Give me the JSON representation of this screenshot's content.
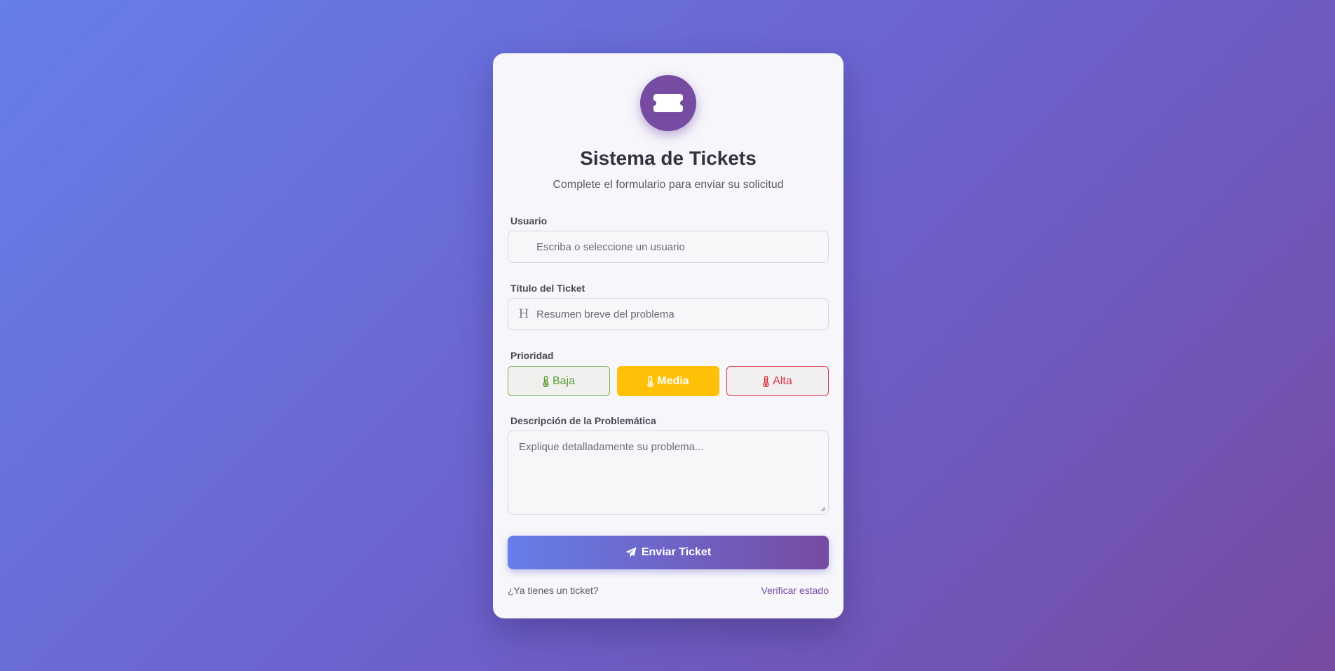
{
  "header": {
    "logo_icon": "ticket-icon",
    "title": "Sistema de Tickets",
    "subtitle": "Complete el formulario para enviar su solicitud"
  },
  "form": {
    "user": {
      "label": "Usuario",
      "placeholder": "Escriba o seleccione un usuario",
      "value": ""
    },
    "ticket_title": {
      "label": "Título del Ticket",
      "icon": "heading-icon",
      "placeholder": "Resumen breve del problema",
      "value": ""
    },
    "priority": {
      "label": "Prioridad",
      "selected": "Media",
      "options": [
        {
          "label": "Baja",
          "icon": "thermometer-icon",
          "color": "#5b9b37"
        },
        {
          "label": "Media",
          "icon": "thermometer-icon",
          "color": "#ffc107"
        },
        {
          "label": "Alta",
          "icon": "thermometer-icon",
          "color": "#dc3545"
        }
      ]
    },
    "description": {
      "label": "Descripción de la Problemática",
      "placeholder": "Explique detalladamente su problema...",
      "value": ""
    },
    "submit": {
      "label": "Enviar Ticket",
      "icon": "paper-plane-icon"
    }
  },
  "footer": {
    "question": "¿Ya tienes un ticket?",
    "link": "Verificar estado"
  },
  "colors": {
    "accent": "#764ba2",
    "gradient_start": "#667eea",
    "gradient_end": "#764ba2"
  }
}
